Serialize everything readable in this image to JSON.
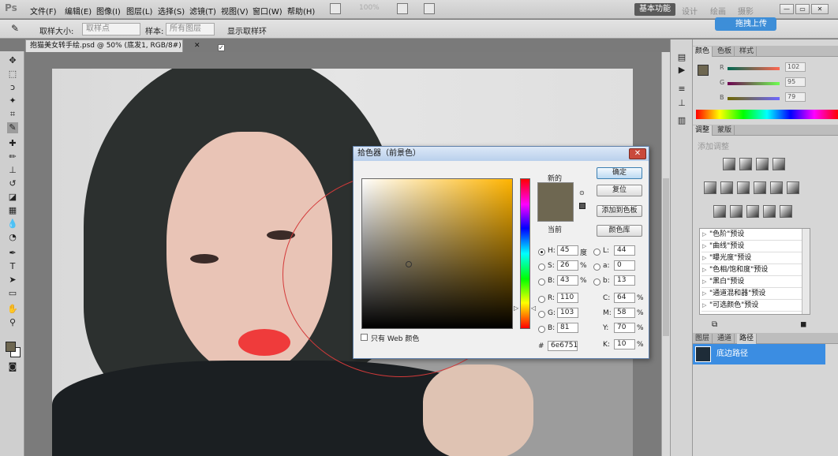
{
  "menubar": {
    "items": [
      "文件(F)",
      "编辑(E)",
      "图像(I)",
      "图层(L)",
      "选择(S)",
      "滤镜(T)",
      "视图(V)",
      "窗口(W)",
      "帮助(H)"
    ],
    "zoom": "100%",
    "workspaces": [
      "基本功能",
      "设计",
      "绘画",
      "摄影"
    ],
    "window_controls": [
      "—",
      "▭",
      "✕"
    ]
  },
  "options_bar": {
    "sample_size_label": "取样大小:",
    "sample_size_value": "取样点",
    "sample_label": "样本:",
    "sample_value": "所有图层",
    "show_ring_label": "显示取样环",
    "cloud_upload": "拖拽上传"
  },
  "document": {
    "tab_title": "抱猫美女转手绘.psd @ 50% (底发1, RGB/8#) *",
    "tab_close": "✕"
  },
  "color_picker": {
    "title": "拾色器（前景色）",
    "close": "✕",
    "label_new": "新的",
    "label_current": "当前",
    "ok": "确定",
    "reset": "复位",
    "add_to_swatches": "添加到色板",
    "color_libraries": "颜色库",
    "web_only": "只有 Web 颜色",
    "hsb": [
      {
        "label": "H:",
        "value": "45",
        "unit": "度",
        "selected": true
      },
      {
        "label": "S:",
        "value": "26",
        "unit": "%",
        "selected": false
      },
      {
        "label": "B:",
        "value": "43",
        "unit": "%",
        "selected": false
      }
    ],
    "rgb": [
      {
        "label": "R:",
        "value": "110"
      },
      {
        "label": "G:",
        "value": "103"
      },
      {
        "label": "B:",
        "value": "81"
      }
    ],
    "lab": [
      {
        "label": "L:",
        "value": "44"
      },
      {
        "label": "a:",
        "value": "0"
      },
      {
        "label": "b:",
        "value": "13"
      }
    ],
    "cmyk": [
      {
        "label": "C:",
        "value": "64",
        "unit": "%"
      },
      {
        "label": "M:",
        "value": "58",
        "unit": "%"
      },
      {
        "label": "Y:",
        "value": "70",
        "unit": "%"
      },
      {
        "label": "K:",
        "value": "10",
        "unit": "%"
      }
    ],
    "hex_label": "#",
    "hex_value": "6e6751",
    "current_color": "#6e6751",
    "hue_color": "#ffb400"
  },
  "right_panel": {
    "color_tabs": [
      "颜色",
      "色板",
      "样式"
    ],
    "color_slider_values": [
      "102",
      "95",
      "79"
    ],
    "adjust_tabs": [
      "调整",
      "蒙版"
    ],
    "add_adjustment": "添加调整",
    "presets": [
      "\"色阶\"预设",
      "\"曲线\"预设",
      "\"曝光度\"预设",
      "\"色相/饱和度\"预设",
      "\"黑白\"预设",
      "\"通道混和器\"预设",
      "\"可选颜色\"预设"
    ],
    "layer_tabs": [
      "图层",
      "通道",
      "路径"
    ],
    "path_name": "底边路径"
  },
  "tools": [
    "move-tool",
    "marquee-tool",
    "lasso-tool",
    "quick-select-tool",
    "crop-tool",
    "eyedropper-tool",
    "healing-tool",
    "brush-tool",
    "stamp-tool",
    "history-brush-tool",
    "eraser-tool",
    "gradient-tool",
    "blur-tool",
    "dodge-tool",
    "pen-tool",
    "type-tool",
    "path-select-tool",
    "shape-tool",
    "hand-tool",
    "zoom-tool"
  ]
}
